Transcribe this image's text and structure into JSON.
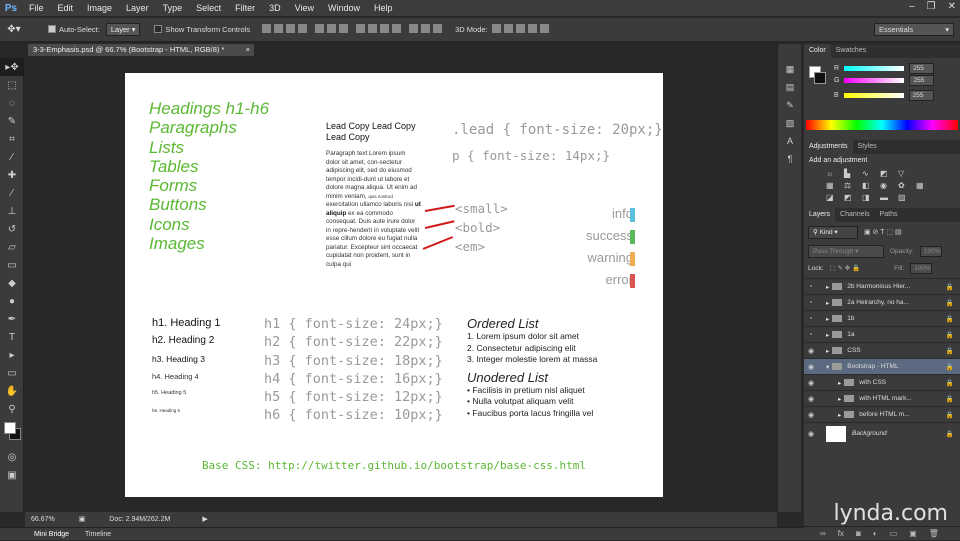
{
  "menu": [
    "File",
    "Edit",
    "Image",
    "Layer",
    "Type",
    "Select",
    "Filter",
    "3D",
    "View",
    "Window",
    "Help"
  ],
  "options": {
    "auto_select": "Auto-Select:",
    "auto_target": "Layer",
    "transform": "Show Transform Controls",
    "mode3d": "3D Mode:",
    "workspace": "Essentials"
  },
  "doc_tab": "3-3-Emphasis.psd @ 66.7% (Bootstrap - HTML, RGB/8) *",
  "doc": {
    "green_list": [
      "Headings h1-h6",
      "Paragraphs",
      "Lists",
      "Tables",
      "Forms",
      "Buttons",
      "Icons",
      "Images"
    ],
    "lead_copy": "Lead Copy Lead Copy Lead Copy",
    "lead_css": ".lead { font-size: 20px;}",
    "p_css": "p { font-size: 14px;}",
    "para_a": "Paragraph text Lorem ipsum dolor sit amet, con-sectetur adipiscing elit, sed do eiusmod tempor incidi-dunt ut labore et dolore magna aliqua. Ut enim ad minim veniam,",
    "para_small": "quis nostrud",
    "para_b": "exercitation ullamco laboris nisi",
    "para_bold": "ut aliquip",
    "para_c": "ex ea commodo consequat. Duis aute irure dolor in repre-henderit in voluptate velit esse cillum dolore eu fugiat nulla pariatur. Excepteur sint occaecat cupidatat non proident, sunt in culpa qui",
    "tags": [
      "<small>",
      "<bold>",
      "<em>"
    ],
    "statuses": [
      {
        "label": "info",
        "color": "#5bc0de"
      },
      {
        "label": "success",
        "color": "#5cb85c"
      },
      {
        "label": "warning",
        "color": "#f0ad4e"
      },
      {
        "label": "error",
        "color": "#d9534f"
      }
    ],
    "headings": [
      "h1. Heading 1",
      "h2. Heading 2",
      "h3. Heading 3",
      "h4. Heading 4",
      "h5. Heading 5",
      "h6. Heading 6"
    ],
    "heading_css": [
      "h1 { font-size: 24px;}",
      "h2 { font-size: 22px;}",
      "h3 { font-size: 18px;}",
      "h4 { font-size: 16px;}",
      "h5 { font-size: 12px;}",
      "h6 { font-size: 10px;}"
    ],
    "ordered_title": "Ordered List",
    "ordered": [
      "1. Lorem ipsum dolor sit amet",
      "2. Consectetur adipiscing elit",
      "3. Integer molestie lorem at massa"
    ],
    "unordered_title": "Unodered List",
    "unordered": [
      "• Facilisis in pretium nisl aliquet",
      "• Nulla volutpat aliquam velit",
      "• Faucibus porta lacus fringilla vel"
    ],
    "base_css": "Base CSS: http://twitter.github.io/bootstrap/base-css.html"
  },
  "status": {
    "zoom": "66.67%",
    "doc_size": "Doc: 2.94M/262.2M"
  },
  "bottom_tabs": [
    "Mini Bridge",
    "Timeline"
  ],
  "color_panel": {
    "tabs": [
      "Color",
      "Swatches"
    ],
    "r": "255",
    "g": "255",
    "b": "255"
  },
  "adj_panel": {
    "tabs": [
      "Adjustments",
      "Styles"
    ],
    "title": "Add an adjustment"
  },
  "layers_panel": {
    "tabs": [
      "Layers",
      "Channels",
      "Paths"
    ],
    "kind": "Kind",
    "blend": "Pass Through",
    "opacity_label": "Opacity:",
    "opacity": "100%",
    "lock_label": "Lock:",
    "fill_label": "Fill:",
    "fill": "100%",
    "layers": [
      {
        "name": "2b Harmonious Hier...",
        "eye": false,
        "indent": 0,
        "open": false
      },
      {
        "name": "2a Heirarchy, no ha...",
        "eye": false,
        "indent": 0,
        "open": false
      },
      {
        "name": "1b",
        "eye": false,
        "indent": 0,
        "open": false
      },
      {
        "name": "1a",
        "eye": false,
        "indent": 0,
        "open": false
      },
      {
        "name": "CSS",
        "eye": false,
        "indent": 0,
        "open": false
      },
      {
        "name": "Bootstrap - HTML",
        "eye": true,
        "indent": 0,
        "open": true,
        "selected": true
      },
      {
        "name": "with CSS",
        "eye": true,
        "indent": 1,
        "open": false
      },
      {
        "name": "with HTML mark...",
        "eye": true,
        "indent": 1,
        "open": false
      },
      {
        "name": "before HTML m...",
        "eye": true,
        "indent": 1,
        "open": false
      },
      {
        "name": "Background",
        "eye": true,
        "indent": 0,
        "open": false,
        "bg": true
      }
    ]
  },
  "watermark": "lynda.com"
}
